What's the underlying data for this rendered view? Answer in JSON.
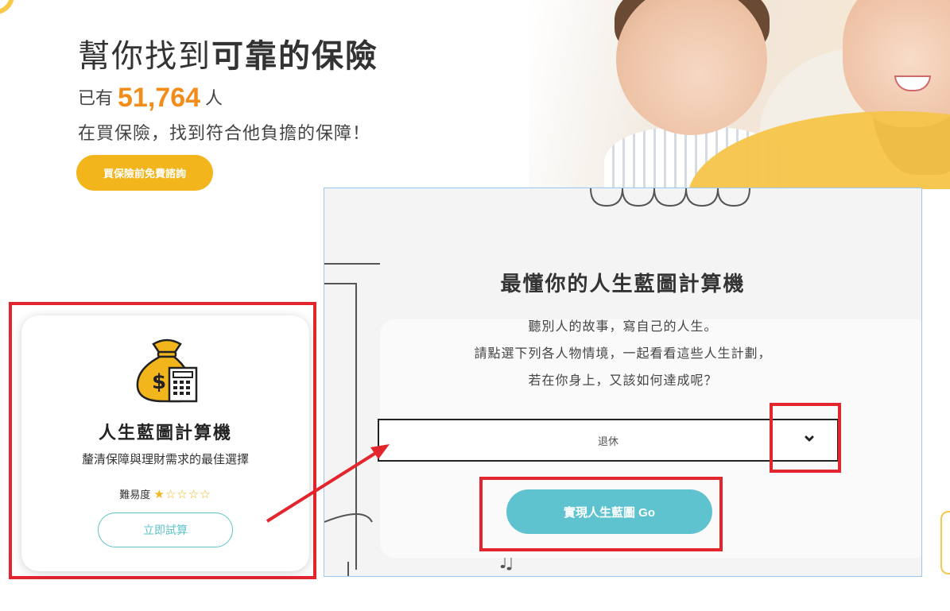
{
  "hero": {
    "title_plain": "幫你找到",
    "title_bold": "可靠的保險",
    "count_prefix": "已有",
    "count_value": "51,764",
    "count_suffix": "人",
    "subtitle": "在買保險，找到符合他負擔的保障！",
    "consult_button": "買保險前免費諮詢"
  },
  "card": {
    "icon": "money-bag-calculator-icon",
    "title": "人生藍圖計算機",
    "description": "釐清保障與理財需求的最佳選擇",
    "difficulty_label": "難易度",
    "difficulty_rating": 1,
    "difficulty_max": 5,
    "stars_display": "★☆☆☆☆",
    "try_button": "立即試算"
  },
  "panel": {
    "title": "最懂你的人生藍圖計算機",
    "lines": [
      "聽別人的故事，寫自己的人生。",
      "請點選下列各人物情境，一起看看這些人生計劃，",
      "若在你身上，又該如何達成呢？"
    ],
    "select_value": "退休",
    "go_button": "實現人生藍圖 Go"
  },
  "colors": {
    "accent_orange": "#f28c1b",
    "accent_yellow": "#f2b51c",
    "teal": "#5ec3cf",
    "annotation_red": "#e3262d"
  }
}
